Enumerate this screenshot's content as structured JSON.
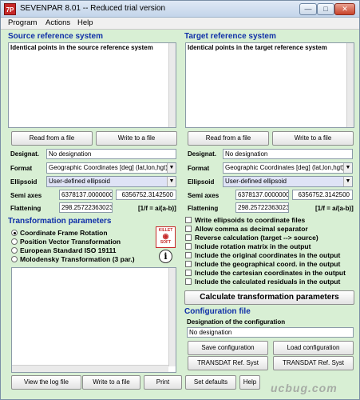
{
  "window": {
    "title": "SEVENPAR 8.01 -- Reduced trial version",
    "icon_text": "7P"
  },
  "menu": [
    "Program",
    "Actions",
    "Help"
  ],
  "source": {
    "title": "Source reference system",
    "points_label": "Identical points in the source reference system",
    "read_button": "Read from a file",
    "write_button": "Write to a file",
    "designat_label": "Designat.",
    "designat_value": "No designation",
    "format_label": "Format",
    "format_value": "Geographic Coordinates [deg] (lat,lon,hgt)",
    "ellipsoid_label": "Ellipsoid",
    "ellipsoid_value": "User-defined ellipsoid",
    "semi_axes_label": "Semi axes",
    "semi_a": "6378137.0000000",
    "semi_b": "6356752.3142500",
    "flattening_label": "Flattening",
    "flattening_value": "298.25722363023",
    "flattening_note": "[1/f = a/(a-b)]"
  },
  "target": {
    "title": "Target reference system",
    "points_label": "Identical points in the target reference system",
    "read_button": "Read from a file",
    "write_button": "Write to a file",
    "designat_label": "Designat.",
    "designat_value": "No designation",
    "format_label": "Format",
    "format_value": "Geographic Coordinates [deg] (lat,lon,hgt)",
    "ellipsoid_label": "Ellipsoid",
    "ellipsoid_value": "User-defined ellipsoid",
    "semi_axes_label": "Semi axes",
    "semi_a": "6378137.0000000",
    "semi_b": "6356752.3142500",
    "flattening_label": "Flattening",
    "flattening_value": "298.25722363023",
    "flattening_note": "[1/f = a/(a-b)]"
  },
  "transformation": {
    "title": "Transformation parameters",
    "options": [
      "Coordinate Frame Rotation",
      "Position Vector Transformation",
      "European Standard ISO 19111",
      "Molodensky Transformation (3 par.)"
    ],
    "selected_index": 0,
    "logo_text": [
      "KILLET",
      "SOFT"
    ],
    "info_icon_glyph": "i"
  },
  "options": {
    "checks": [
      "Write ellipsoids to coordinate files",
      "Allow comma as decimal separator",
      "Reverse calculation (target --> source)",
      "Include rotation matrix in the output",
      "Include the original coordinates in the output",
      "Include the geographical coord. in the output",
      "Include the cartesian coordinates in the output",
      "Include the calculated residuals in the output"
    ],
    "calculate_button": "Calculate transformation parameters"
  },
  "configuration": {
    "title": "Configuration file",
    "designation_label": "Designation of the configuration",
    "designation_value": "No designation",
    "save_button": "Save configuration",
    "load_button": "Load configuration",
    "transdat_button": "TRANSDAT Ref. Syst",
    "transdat2_button": "TRANSDAT Ref. Syst"
  },
  "bottom_buttons": [
    "View the log file",
    "Write to a file",
    "Print",
    "Set defaults",
    "Help"
  ],
  "watermark": "ucbug.com",
  "colors": {
    "background": "#d8efd4",
    "section_title": "#1030a8",
    "selected_field": "#dfe3f6"
  }
}
